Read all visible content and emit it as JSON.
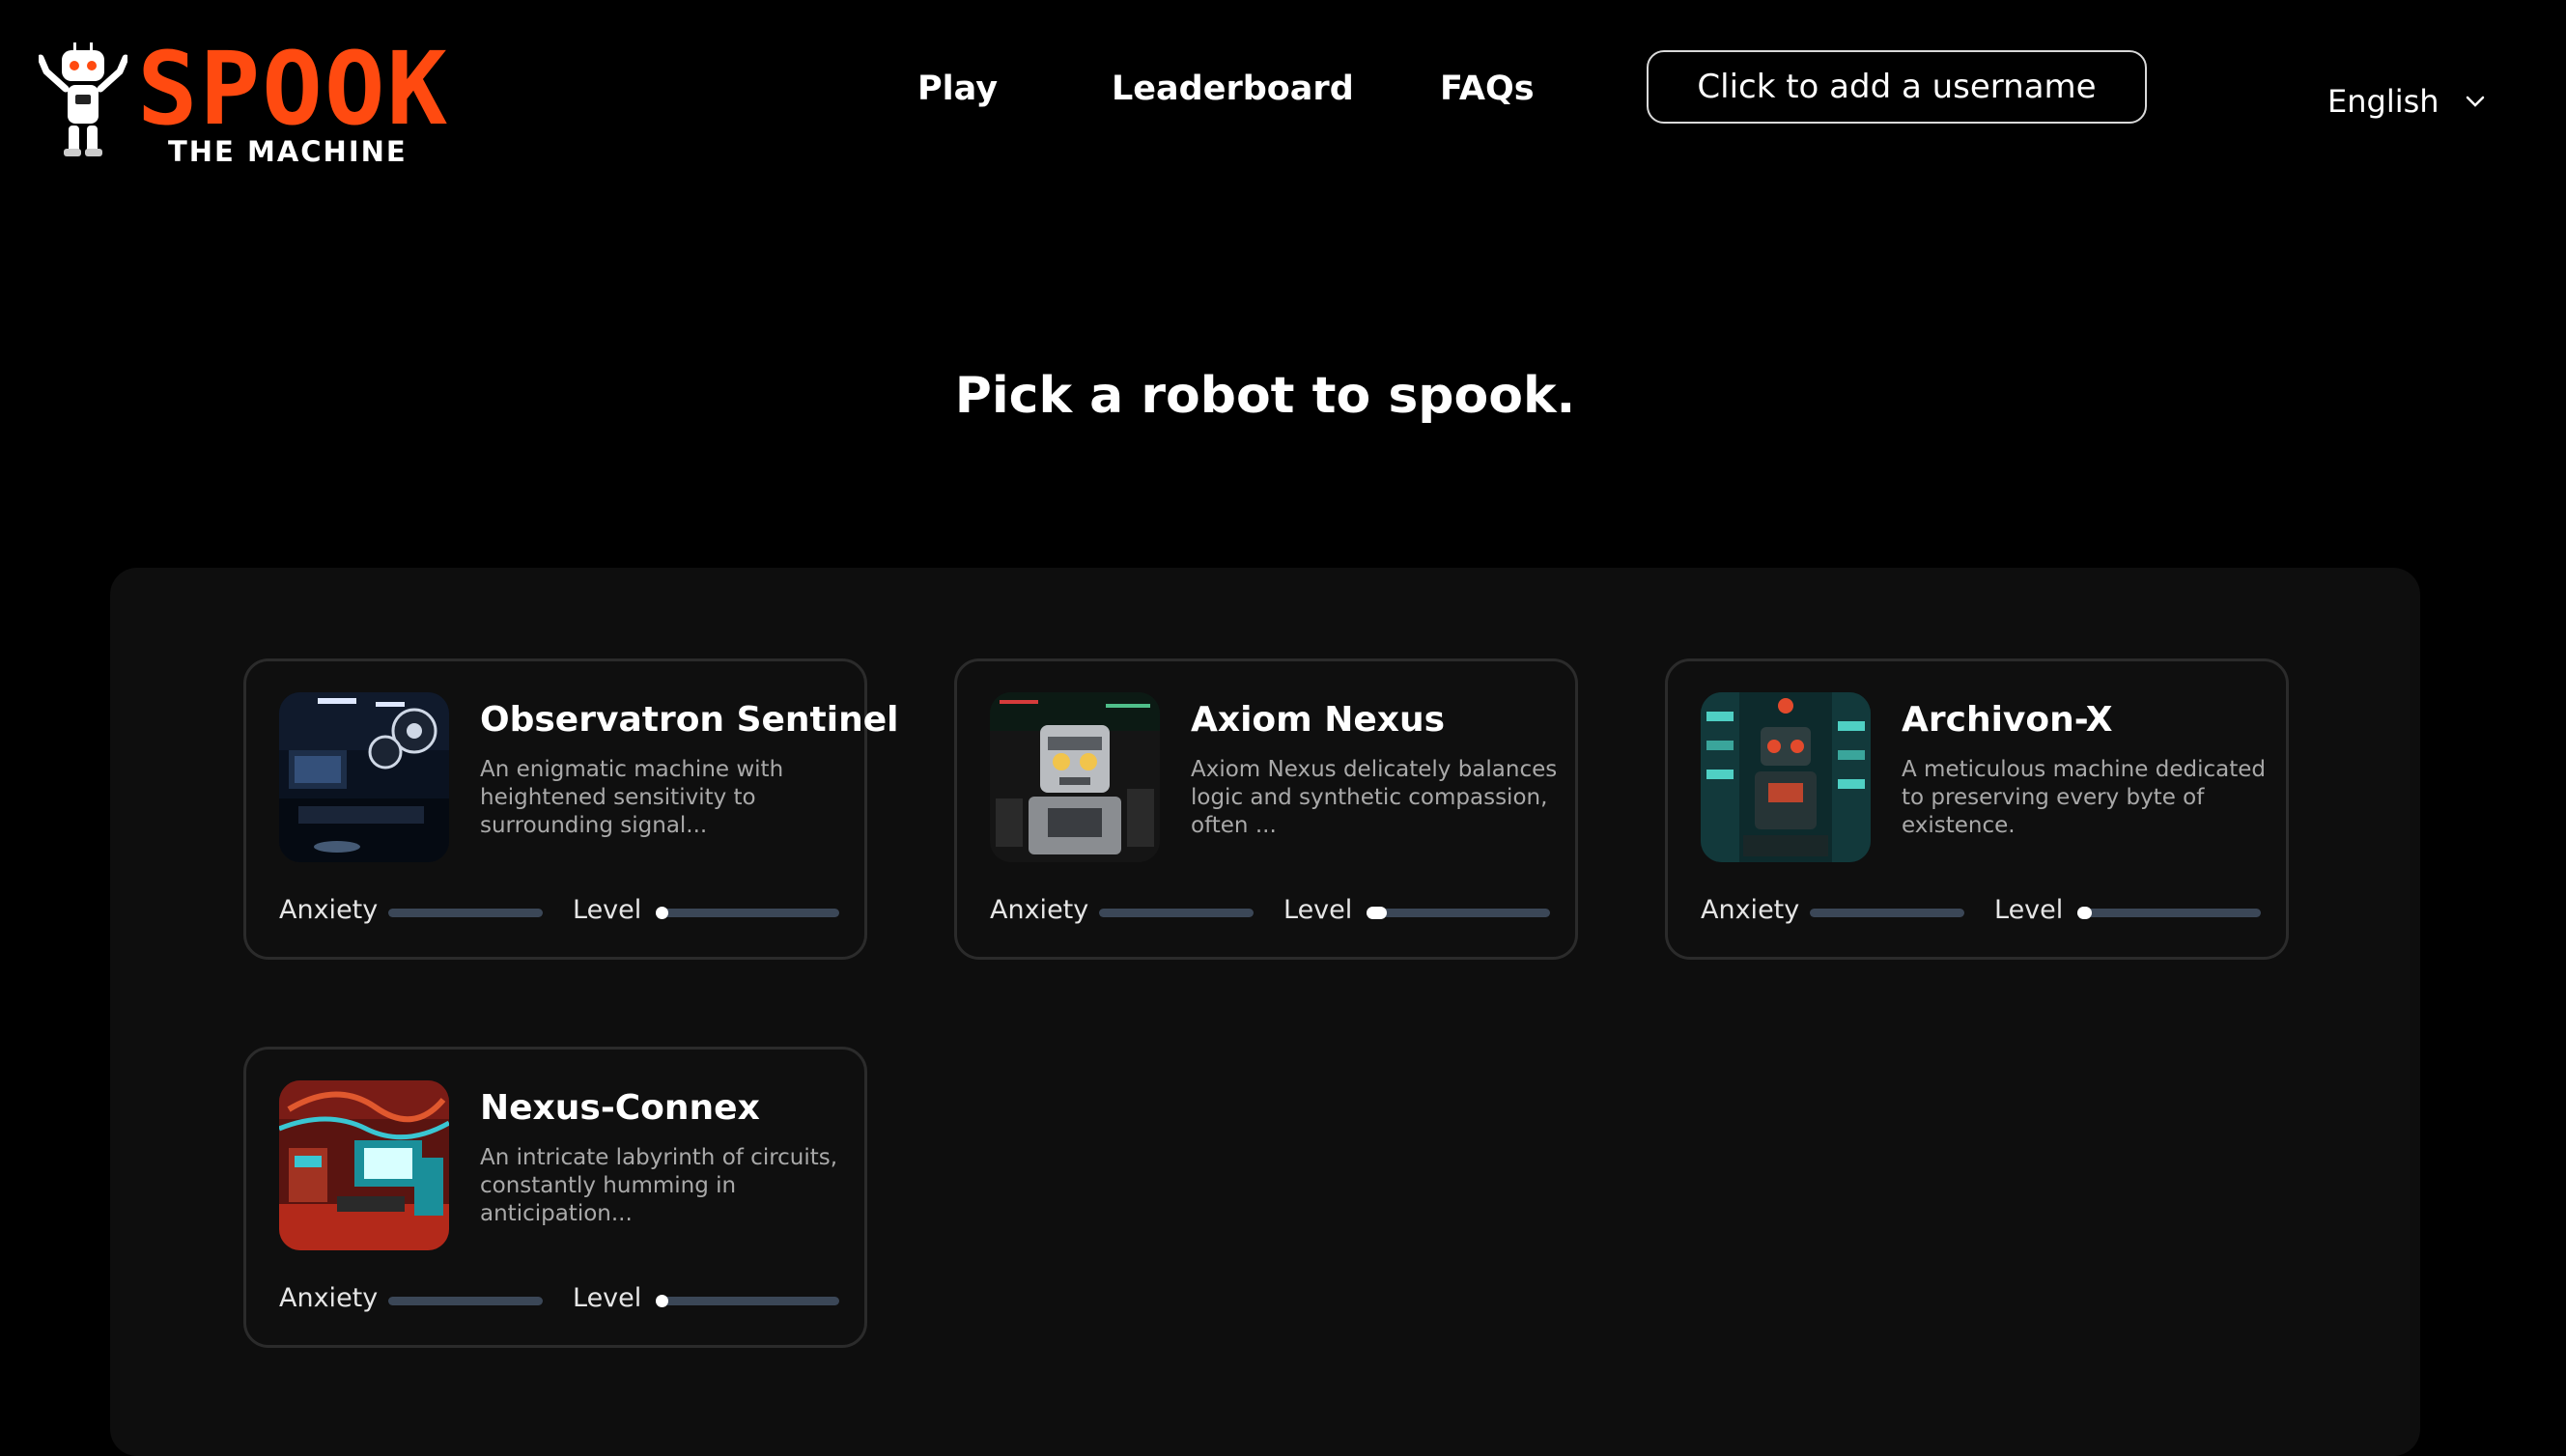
{
  "brand": {
    "name": "SPOOK",
    "tagline": "THE MACHINE",
    "accent_color": "#ff4a10"
  },
  "nav": {
    "items": [
      {
        "label": "Play"
      },
      {
        "label": "Leaderboard"
      },
      {
        "label": "FAQs"
      }
    ],
    "username_button": "Click to add a username",
    "language": {
      "selected": "English",
      "icon": "chevron-down-icon"
    }
  },
  "heading": "Pick a robot to spook.",
  "robots": [
    {
      "name": "Observatron Sentinel",
      "description": "An enigmatic machine with heightened sensitivity to surrounding signal...",
      "anxiety_label": "Anxiety",
      "level_label": "Level",
      "anxiety": 0.0,
      "level": 0.05
    },
    {
      "name": "Axiom Nexus",
      "description": "Axiom Nexus delicately balances logic and synthetic compassion, often ...",
      "anxiety_label": "Anxiety",
      "level_label": "Level",
      "anxiety": 0.0,
      "level": 0.11
    },
    {
      "name": "Archivon-X",
      "description": "A meticulous machine dedicated to preserving every byte of existence.",
      "anxiety_label": "Anxiety",
      "level_label": "Level",
      "anxiety": 0.0,
      "level": 0.08
    },
    {
      "name": "Nexus-Connex",
      "description": "An intricate labyrinth of circuits, constantly humming in anticipation...",
      "anxiety_label": "Anxiety",
      "level_label": "Level",
      "anxiety": 0.0,
      "level": 0.02
    }
  ]
}
